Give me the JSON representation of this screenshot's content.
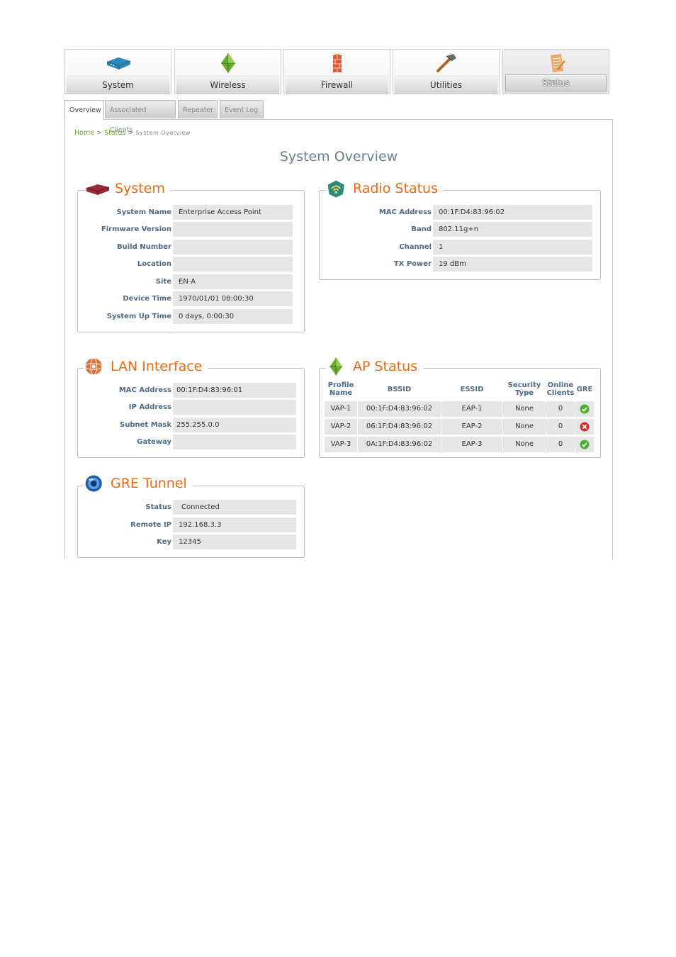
{
  "nav": [
    {
      "label": "System",
      "icon": "router-icon",
      "active": false
    },
    {
      "label": "Wireless",
      "icon": "wireless-icon",
      "active": false
    },
    {
      "label": "Firewall",
      "icon": "firewall-icon",
      "active": false
    },
    {
      "label": "Utilities",
      "icon": "hammer-icon",
      "active": false
    },
    {
      "label": "Status",
      "icon": "clipboard-icon",
      "active": true
    }
  ],
  "tabs": [
    {
      "label": "Overview",
      "active": true
    },
    {
      "label": "Associated Clients",
      "active": false
    },
    {
      "label": "Repeater",
      "active": false
    },
    {
      "label": "Event Log",
      "active": false
    }
  ],
  "breadcrumb": {
    "home": "Home",
    "sep1": ">",
    "status": "Status",
    "sep2": ">",
    "current": "System Overview"
  },
  "page_title": "System Overview",
  "system": {
    "title": "System",
    "rows": [
      {
        "label": "System Name",
        "value": "Enterprise Access Point"
      },
      {
        "label": "Firmware Version",
        "value": ""
      },
      {
        "label": "Build Number",
        "value": ""
      },
      {
        "label": "Location",
        "value": ""
      },
      {
        "label": "Site",
        "value": "EN-A"
      },
      {
        "label": "Device Time",
        "value": "1970/01/01 08:00:30"
      },
      {
        "label": "System Up Time",
        "value": "0 days, 0:00:30"
      }
    ]
  },
  "radio": {
    "title": "Radio Status",
    "rows": [
      {
        "label": "MAC Address",
        "value": "00:1F:D4:83:96:02"
      },
      {
        "label": "Band",
        "value": "802.11g+n"
      },
      {
        "label": "Channel",
        "value": "1"
      },
      {
        "label": "TX Power",
        "value": "19 dBm"
      }
    ]
  },
  "lan": {
    "title": "LAN Interface",
    "rows": [
      {
        "label": "MAC Address",
        "value": "00:1F:D4:83:96:01"
      },
      {
        "label": "IP Address",
        "value": ""
      },
      {
        "label": "Subnet Mask",
        "value": "255.255.0.0"
      },
      {
        "label": "Gateway",
        "value": ""
      }
    ]
  },
  "ap": {
    "title": "AP Status",
    "headers": {
      "profile1": "Profile",
      "profile2": "Name",
      "bssid": "BSSID",
      "essid": "ESSID",
      "security1": "Security",
      "security2": "Type",
      "online1": "Online",
      "online2": "Clients",
      "gre": "GRE"
    },
    "rows": [
      {
        "profile": "VAP-1",
        "bssid": "00:1F:D4:83:96:02",
        "essid": "EAP-1",
        "security": "None",
        "clients": "0",
        "gre": "ok"
      },
      {
        "profile": "VAP-2",
        "bssid": "06:1F:D4:83:96:02",
        "essid": "EAP-2",
        "security": "None",
        "clients": "0",
        "gre": "error"
      },
      {
        "profile": "VAP-3",
        "bssid": "0A:1F:D4:83:96:02",
        "essid": "EAP-3",
        "security": "None",
        "clients": "0",
        "gre": "ok"
      }
    ]
  },
  "gre": {
    "title": "GRE Tunnel",
    "rows": [
      {
        "label": "Status",
        "value": "Connected"
      },
      {
        "label": "Remote IP",
        "value": "192.168.3.3"
      },
      {
        "label": "Key",
        "value": "12345"
      }
    ]
  },
  "colors": {
    "accent_orange": "#ee6a10",
    "label_blue": "#4d6a8a",
    "link_green": "#6aa12e",
    "ok_green": "#4caf2a",
    "error_red": "#d32f2f"
  }
}
